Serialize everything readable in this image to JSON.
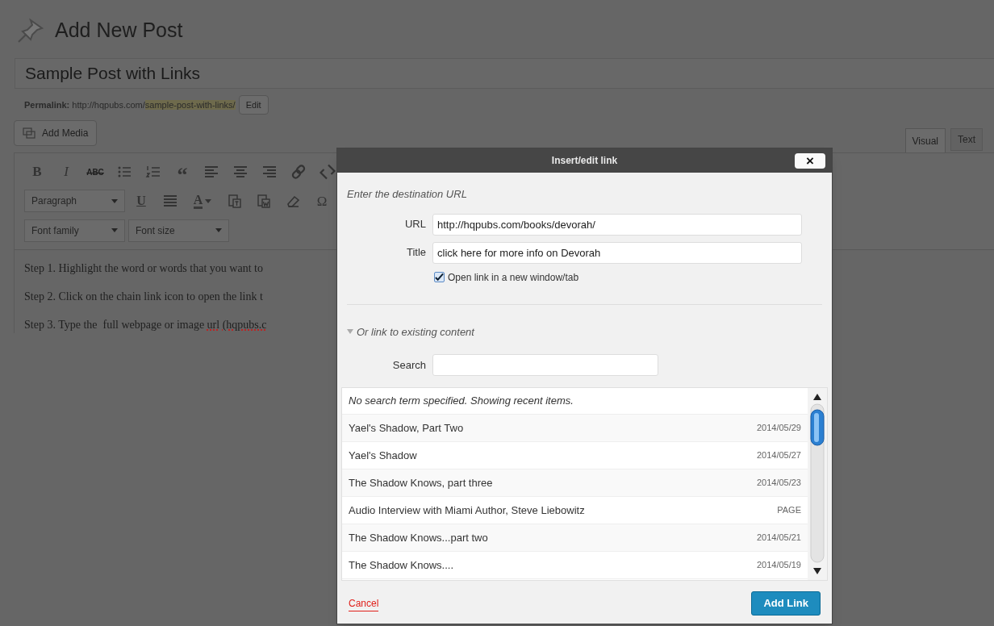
{
  "page": {
    "heading": "Add New Post"
  },
  "post_title": {
    "value": "Sample Post with Links"
  },
  "permalink": {
    "label": "Permalink:",
    "url": "http://hqpubs.com/",
    "slug": "sample-post-with-links/",
    "edit_button": "Edit"
  },
  "add_media_button": "Add Media",
  "editor_tabs": [
    {
      "label": "Visual",
      "selected": true
    },
    {
      "label": "Text",
      "selected": false
    }
  ],
  "toolbar_rows": [
    [
      {
        "kind": "bold",
        "label": "B"
      },
      {
        "kind": "italic",
        "label": "I"
      },
      {
        "kind": "strike",
        "label": "ABC"
      },
      {
        "kind": "bullets"
      },
      {
        "kind": "numbers"
      },
      {
        "kind": "quote",
        "label": "“"
      },
      {
        "kind": "align-left"
      },
      {
        "kind": "align-center"
      },
      {
        "kind": "align-right"
      },
      {
        "kind": "link"
      },
      {
        "kind": "unlink"
      }
    ],
    [
      {
        "kind": "dropdown",
        "label": "Paragraph"
      },
      {
        "kind": "underline",
        "label": "U"
      },
      {
        "kind": "justify"
      },
      {
        "kind": "color",
        "label": "A"
      },
      {
        "kind": "paste-text"
      },
      {
        "kind": "paste-word"
      },
      {
        "kind": "eraser"
      },
      {
        "kind": "symbol",
        "label": "Ω"
      }
    ],
    [
      {
        "kind": "dropdown",
        "label": "Font family"
      },
      {
        "kind": "dropdown",
        "label": "Font size"
      }
    ]
  ],
  "content_paragraphs": [
    [
      {
        "text": "Step 1. Highlight the word or words that you want to",
        "misspelled": false
      }
    ],
    [
      {
        "text": "Step 2. Click on the chain link icon to open the link t",
        "misspelled": false
      }
    ],
    [
      {
        "text": "Step 3. Type the  full webpage or image",
        "misspelled": false
      },
      {
        "text": "url",
        "misspelled": true
      },
      {
        "text": "(hqpubs.c",
        "misspelled": true
      }
    ]
  ],
  "dialog": {
    "title": "Insert/edit link",
    "close": "×",
    "intro": "Enter the destination URL",
    "fields": [
      {
        "label": "URL",
        "value": "http://hqpubs.com/books/devorah/"
      },
      {
        "label": "Title",
        "value": "click here for more info on Devorah"
      }
    ],
    "new_window": {
      "label": "Open link in a new window/tab",
      "checked": true
    },
    "existing_toggle": {
      "label": "Or link to existing content",
      "expanded": true
    },
    "search": {
      "label": "Search"
    },
    "results_note": "No search term specified. Showing recent items.",
    "results": [
      {
        "title": "Yael's Shadow, Part Two",
        "info": "2014/05/29"
      },
      {
        "title": "Yael's Shadow",
        "info": "2014/05/27"
      },
      {
        "title": "The Shadow Knows, part three",
        "info": "2014/05/23"
      },
      {
        "title": "Audio Interview with Miami Author, Steve Liebowitz",
        "info": "PAGE"
      },
      {
        "title": "The Shadow Knows...part two",
        "info": "2014/05/21"
      },
      {
        "title": "The Shadow Knows....",
        "info": "2014/05/19"
      }
    ],
    "cancel": "Cancel",
    "submit": "Add Link"
  }
}
